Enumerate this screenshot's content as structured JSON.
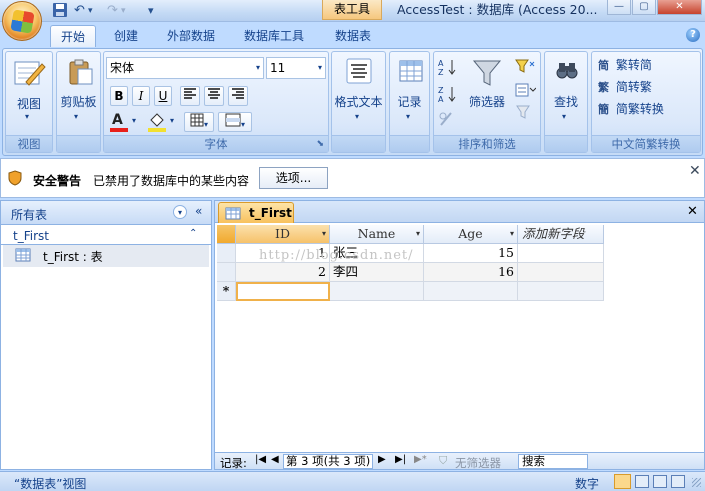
{
  "title_bar": {
    "context_tab": "表工具",
    "app_title": "AccessTest : 数据库 (Access 20...",
    "quick_access": {
      "undo": "↶",
      "redo": "↷",
      "customize": "▾"
    }
  },
  "ribbon_tabs": [
    {
      "label": "开始",
      "active": true
    },
    {
      "label": "创建"
    },
    {
      "label": "外部数据"
    },
    {
      "label": "数据库工具"
    },
    {
      "label": "数据表"
    }
  ],
  "ribbon": {
    "view": {
      "button": "视图",
      "group": "视图"
    },
    "clipboard": {
      "button": "剪贴板"
    },
    "font": {
      "group": "字体",
      "font_name": "宋体",
      "font_size": "11",
      "bold": "B",
      "italic": "I",
      "underline": "U",
      "font_color_letter": "A"
    },
    "rich_text": {
      "button": "格式文本"
    },
    "records": {
      "button": "记录"
    },
    "sort_filter": {
      "group": "排序和筛选",
      "filter": "筛选器"
    },
    "find": {
      "button": "查找"
    },
    "chinese_conv": {
      "group": "中文简繁转换",
      "to_simplified": "繁转简",
      "to_traditional": "简转繁",
      "convert": "简繁转换"
    }
  },
  "security": {
    "label": "安全警告",
    "message": "已禁用了数据库中的某些内容",
    "options_button": "选项..."
  },
  "nav": {
    "header": "所有表",
    "group": "t_First",
    "items": [
      {
        "label": "t_First : 表"
      }
    ]
  },
  "document": {
    "tab_title": "t_First",
    "columns": [
      "ID",
      "Name",
      "Age",
      "添加新字段"
    ],
    "rows": [
      {
        "id": "1",
        "name": "张三",
        "age": "15"
      },
      {
        "id": "2",
        "name": "李四",
        "age": "16"
      }
    ],
    "new_row_marker": "*",
    "watermark": "http://blog.csdn.net/",
    "record_nav": {
      "label": "记录:",
      "position": "第 3 项(共 3 项)",
      "filter": "无筛选器",
      "search": "搜索"
    }
  },
  "status": {
    "view": "“数据表”视图",
    "mode": "数字"
  }
}
